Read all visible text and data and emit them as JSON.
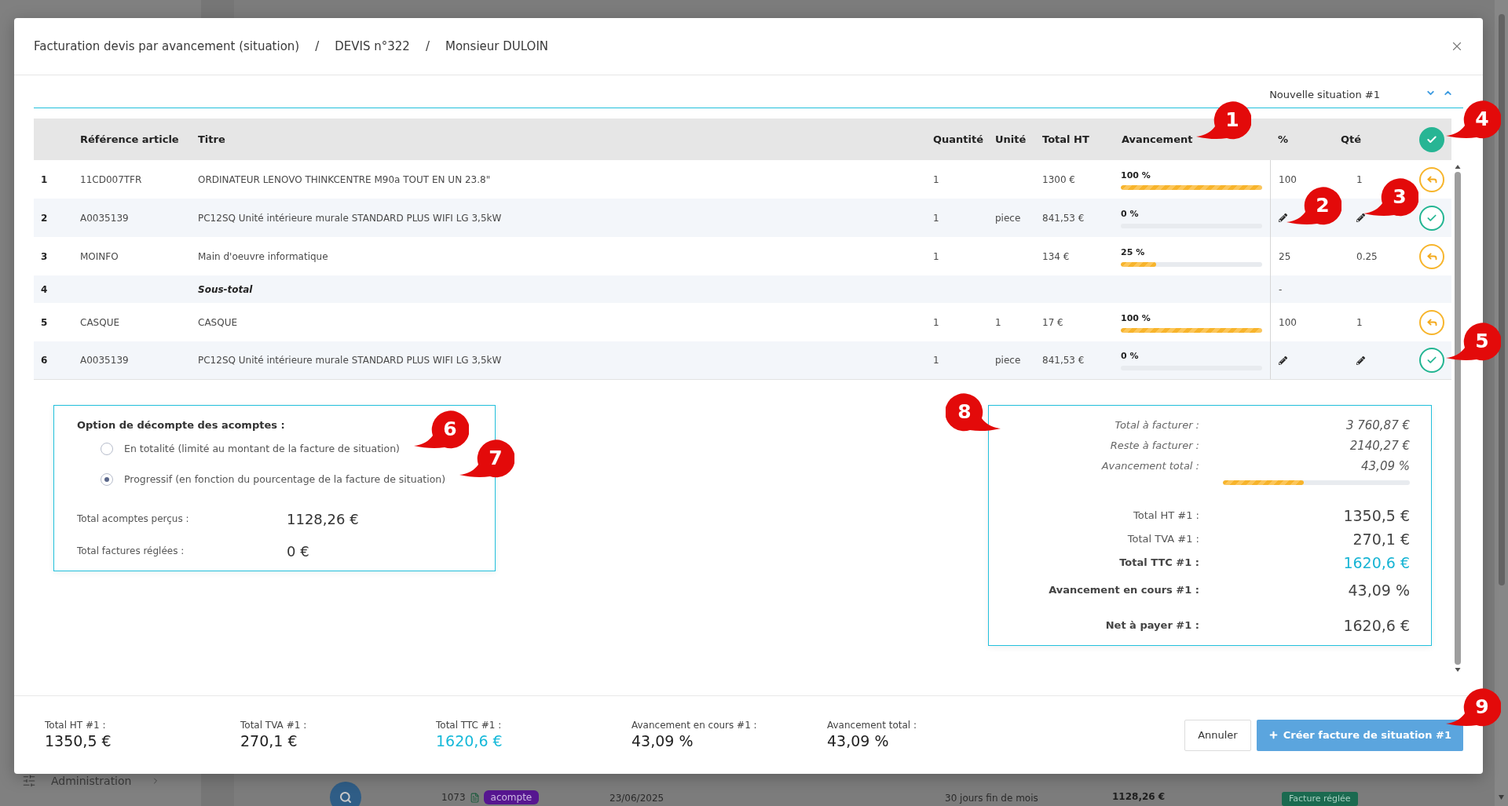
{
  "background": {
    "sidebar_item": "Administration",
    "row": {
      "number": "1073",
      "tag": "acompte",
      "date": "23/06/2025",
      "terms": "30 jours fin de mois",
      "amount": "1128,26 €",
      "status": "Facture réglée"
    }
  },
  "modal": {
    "breadcrumb": [
      {
        "label": "Facturation devis par avancement (situation)",
        "separator": "/"
      },
      {
        "label": "DEVIS n°322",
        "separator": "/"
      },
      {
        "label": "Monsieur DULOIN"
      }
    ],
    "situation": {
      "label": "Nouvelle situation #1"
    },
    "table": {
      "columns": [
        "Référence article",
        "Titre",
        "Quantité",
        "Unité",
        "Total HT",
        "Avancement",
        "%",
        "Qté"
      ],
      "rows": [
        {
          "kind": "item",
          "index": "1",
          "reference": "11CD007TFR",
          "title": "ORDINATEUR LENOVO THINKCENTRE M90a TOUT EN UN 23.8\"",
          "quantity": "1",
          "total_ht": "1300 €",
          "progress": "100 %",
          "level": 1,
          "validated": true,
          "percent": "100",
          "qty": "1"
        },
        {
          "kind": "item",
          "index": "2",
          "reference": "A0035139",
          "title": "PC12SQ Unité intérieure murale STANDARD PLUS WIFI LG 3,5kW",
          "quantity": "1",
          "unit": "piece",
          "total_ht": "841,53 €",
          "progress": "0 %",
          "level": 0,
          "validated": false
        },
        {
          "kind": "item",
          "index": "3",
          "reference": "MOINFO",
          "title": "Main d'oeuvre informatique",
          "quantity": "1",
          "total_ht": "134 €",
          "progress": "25 %",
          "level": 0.25,
          "validated": true,
          "percent": "25",
          "qty": "0.25"
        },
        {
          "kind": "subtotal",
          "index": "4",
          "title": "Sous-total",
          "percent": "-"
        },
        {
          "kind": "item",
          "index": "5",
          "reference": "CASQUE",
          "title": "CASQUE",
          "quantity": "1",
          "unit": "1",
          "total_ht": "17 €",
          "progress": "100 %",
          "level": 1,
          "validated": true,
          "percent": "100",
          "qty": "1"
        },
        {
          "kind": "item",
          "index": "6",
          "reference": "A0035139",
          "title": "PC12SQ Unité intérieure murale STANDARD PLUS WIFI LG 3,5kW",
          "quantity": "1",
          "unit": "piece",
          "total_ht": "841,53 €",
          "progress": "0 %",
          "level": 0,
          "validated": false
        }
      ]
    },
    "deposit_option": {
      "title": "Option de décompte des acomptes :",
      "options": [
        {
          "label": "En totalité (limité au montant de la facture de situation)",
          "selected": false
        },
        {
          "label": "Progressif (en fonction du pourcentage de la facture de situation)",
          "selected": true
        }
      ],
      "totals": [
        {
          "label": "Total acomptes perçus :",
          "value": "1128,26 €"
        },
        {
          "label": "Total factures réglées :",
          "value": "0 €"
        }
      ]
    },
    "summary": {
      "rows": [
        {
          "kind": "muted",
          "label": "Total à facturer :",
          "value": "3 760,87 €"
        },
        {
          "kind": "muted",
          "label": "Reste à facturer :",
          "value": "2140,27 €"
        },
        {
          "kind": "muted",
          "label": "Avancement total :",
          "value": "43,09 %",
          "level": 0.4309
        },
        {
          "kind": "plain",
          "label": "Total HT #1 :",
          "value": "1350,5 €"
        },
        {
          "kind": "plain",
          "label": "Total TVA #1 :",
          "value": "270,1 €"
        },
        {
          "kind": "accent",
          "label": "Total TTC #1 :",
          "value": "1620,6 €"
        },
        {
          "kind": "strong",
          "label": "Avancement en cours #1 :",
          "value": "43,09 %"
        },
        {
          "kind": "strong",
          "label": "Net à payer #1 :",
          "value": "1620,6 €"
        }
      ]
    },
    "footer": {
      "stats": [
        {
          "label": "Total HT #1 :",
          "value": "1350,5 €",
          "accent": false
        },
        {
          "label": "Total TVA #1 :",
          "value": "270,1 €",
          "accent": false
        },
        {
          "label": "Total TTC #1 :",
          "value": "1620,6 €",
          "accent": true
        },
        {
          "label": "Avancement en cours #1 :",
          "value": "43,09 %",
          "accent": false
        },
        {
          "label": "Avancement total :",
          "value": "43,09 %",
          "accent": false
        }
      ],
      "buttons": [
        {
          "kind": "secondary",
          "label": "Annuler"
        },
        {
          "kind": "primary",
          "label": "Créer facture de situation #1"
        }
      ]
    }
  },
  "callouts": [
    "1",
    "2",
    "3",
    "4",
    "5",
    "6",
    "7",
    "8",
    "9"
  ]
}
